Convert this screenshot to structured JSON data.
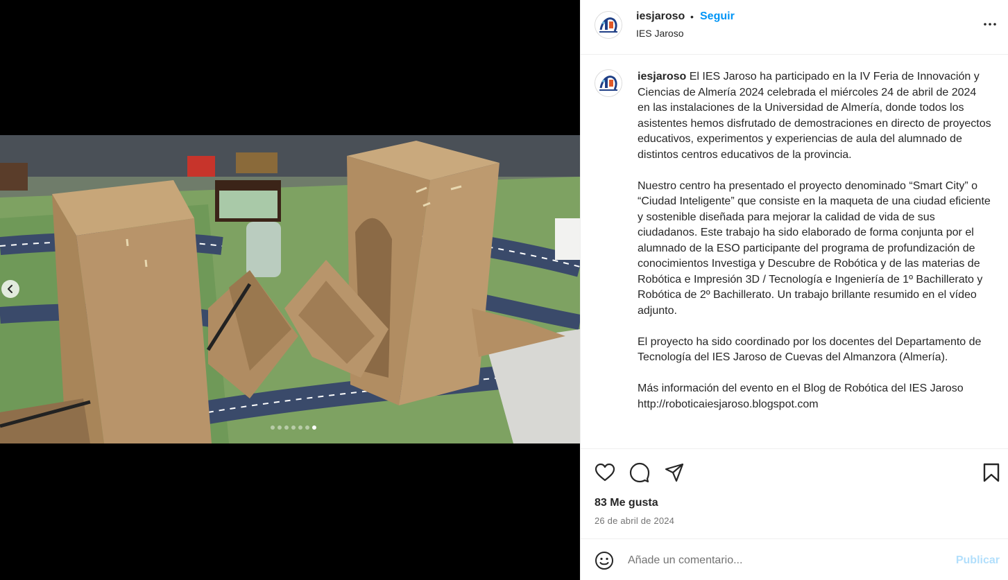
{
  "post": {
    "carousel": {
      "slide_count": 7,
      "active_slide": 7
    }
  },
  "header": {
    "username": "iesjaroso",
    "separator": "•",
    "follow_label": "Seguir",
    "subtitle": "IES Jaroso",
    "more_icon": "more-horizontal-icon"
  },
  "caption": {
    "username": "iesjaroso",
    "paragraph_1": " El IES Jaroso ha participado en la IV Feria de Innovación y Ciencias de Almería 2024 celebrada el miércoles 24 de abril de 2024 en las instalaciones de la Universidad de Almería, donde todos los asistentes hemos disfrutado de demostraciones en directo de proyectos educativos, experimentos y experiencias de aula del alumnado de distintos centros educativos de la provincia.",
    "paragraph_2": "Nuestro centro ha presentado el proyecto denominado “Smart City” o “Ciudad Inteligente” que consiste en la maqueta de una ciudad eficiente y sostenible diseñada para mejorar la calidad de vida de sus ciudadanos. Este trabajo ha sido elaborado de forma conjunta por el alumnado de la ESO participante del programa de profundización de conocimientos Investiga y Descubre de Robótica y de las materias de Robótica e Impresión 3D / Tecnología e Ingeniería de 1º Bachillerato y Robótica de 2º Bachillerato. Un trabajo brillante resumido en el vídeo adjunto.",
    "paragraph_3": "El proyecto ha sido coordinado por los docentes del Departamento de Tecnología del IES Jaroso de Cuevas del Almanzora (Almería).",
    "paragraph_4": "Más información del evento en el Blog de Robótica del IES Jaroso http://roboticaiesjaroso.blogspot.com"
  },
  "actions": {
    "like_icon": "heart-icon",
    "comment_icon": "comment-icon",
    "share_icon": "share-icon",
    "save_icon": "bookmark-icon",
    "likes_text": "83 Me gusta",
    "date_text": "26 de abril de 2024"
  },
  "comment_bar": {
    "emoji_icon": "emoji-icon",
    "placeholder": "Añade un comentario...",
    "publish_label": "Publicar"
  },
  "colors": {
    "accent": "#0095f6",
    "publish_disabled": "#b2dffc",
    "secondary_text": "#737373",
    "border": "#efefef"
  }
}
